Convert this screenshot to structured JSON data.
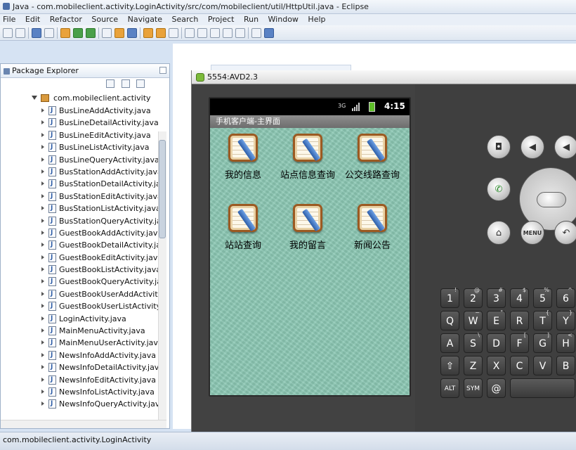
{
  "window": {
    "title": "Java - com.mobileclient.activity.LoginActivity/src/com/mobileclient/util/HttpUtil.java - Eclipse"
  },
  "menu": [
    "File",
    "Edit",
    "Refactor",
    "Source",
    "Navigate",
    "Search",
    "Project",
    "Run",
    "Window",
    "Help"
  ],
  "package_explorer": {
    "title": "Package Explorer",
    "package": "com.mobileclient.activity",
    "files": [
      "BusLineAddActivity.java",
      "BusLineDetailActivity.java",
      "BusLineEditActivity.java",
      "BusLineListActivity.java",
      "BusLineQueryActivity.java",
      "BusStationAddActivity.java",
      "BusStationDetailActivity.java",
      "BusStationEditActivity.java",
      "BusStationListActivity.java",
      "BusStationQueryActivity.java",
      "GuestBookAddActivity.java",
      "GuestBookDetailActivity.java",
      "GuestBookEditActivity.java",
      "GuestBookListActivity.java",
      "GuestBookQueryActivity.java",
      "GuestBookUserAddActivity.java",
      "GuestBookUserListActivity.java",
      "LoginActivity.java",
      "MainMenuActivity.java",
      "MainMenuUserActivity.java",
      "NewsInfoAddActivity.java",
      "NewsInfoDetailActivity.java",
      "NewsInfoEditActivity.java",
      "NewsInfoListActivity.java",
      "NewsInfoQueryActivity.java"
    ]
  },
  "emulator": {
    "title": "5554:AVD2.3",
    "time": "4:15",
    "network": "3G",
    "app_title": "手机客户端-主界面",
    "tiles": [
      "我的信息",
      "站点信息查询",
      "公交线路查询",
      "站站查询",
      "我的留言",
      "新闻公告"
    ]
  },
  "keyboard": {
    "row1": [
      [
        "1",
        "!"
      ],
      [
        "2",
        "@"
      ],
      [
        "3",
        "#"
      ],
      [
        "4",
        "$"
      ],
      [
        "5",
        "%"
      ],
      [
        "6",
        "^"
      ]
    ],
    "row2": [
      [
        "Q",
        ""
      ],
      [
        "W",
        "~"
      ],
      [
        "E",
        "\""
      ],
      [
        "R",
        ""
      ],
      [
        "T",
        "{"
      ],
      [
        "Y",
        "}"
      ]
    ],
    "row3": [
      [
        "A",
        ""
      ],
      [
        "S",
        "\\"
      ],
      [
        "D",
        ""
      ],
      [
        "F",
        "["
      ],
      [
        "G",
        "]"
      ],
      [
        "H",
        "<"
      ]
    ],
    "row4": [
      [
        "⇧",
        ""
      ],
      [
        "Z",
        ""
      ],
      [
        "X",
        ""
      ],
      [
        "C",
        ""
      ],
      [
        "V",
        ""
      ],
      [
        "B",
        ""
      ]
    ],
    "row5": [
      [
        "ALT",
        ""
      ],
      [
        "SYM",
        ""
      ],
      [
        "@",
        ""
      ],
      [
        "",
        ""
      ]
    ]
  },
  "statusbar": {
    "text": "com.mobileclient.activity.LoginActivity"
  }
}
